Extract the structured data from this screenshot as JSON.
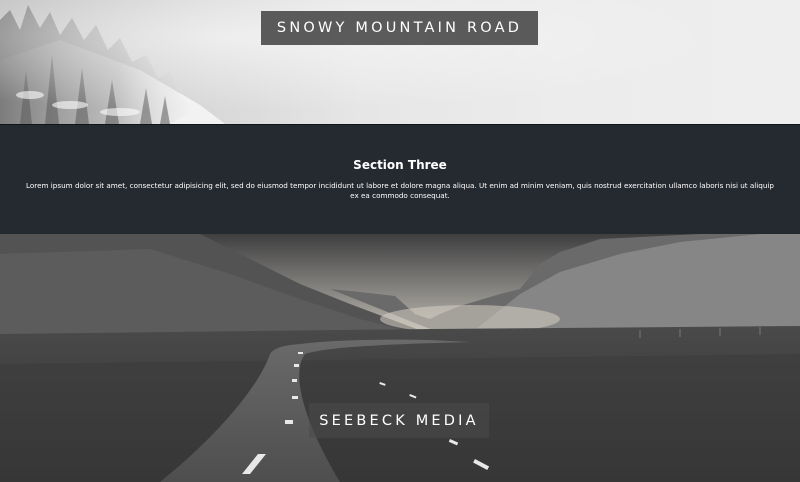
{
  "hero_top": {
    "title": "SNOWY MOUNTAIN ROAD",
    "image_subject": "snowy-forest-mountain"
  },
  "section_three": {
    "heading": "Section Three",
    "body": "Lorem ipsum dolor sit amet, consectetur adipisicing elit, sed do eiusmod tempor incididunt ut labore et dolore magna aliqua. Ut enim ad minim veniam, quis nostrud exercitation ullamco laboris nisi ut aliquip ex ea commodo consequat."
  },
  "hero_bottom": {
    "brand": "SEEBECK MEDIA",
    "image_subject": "mountain-valley-road"
  },
  "colors": {
    "dark_band": "#252a31",
    "caption_box": "#464646",
    "text": "#ffffff"
  }
}
